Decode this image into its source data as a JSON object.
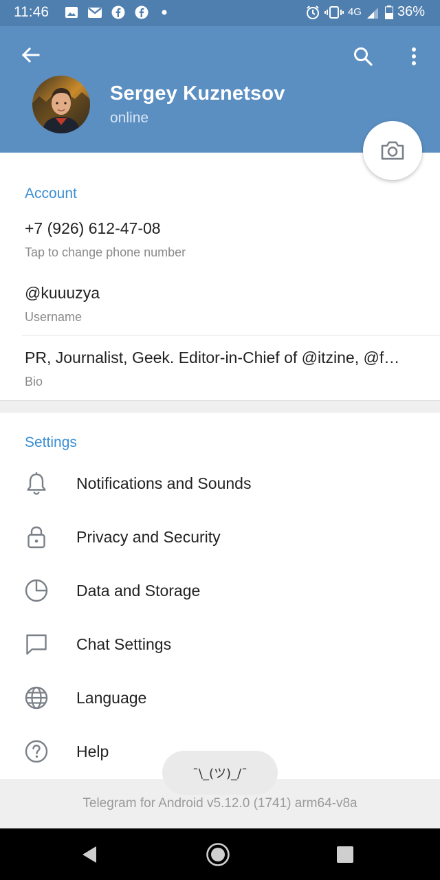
{
  "status_bar": {
    "time": "11:46",
    "network": "4G",
    "battery": "36%",
    "notification_icons": [
      "image-icon",
      "gmail-icon",
      "facebook-icon",
      "facebook-icon",
      "dot-icon"
    ],
    "right_icons": [
      "alarm-icon",
      "vibrate-icon",
      "signal-icon",
      "battery-icon"
    ]
  },
  "header": {
    "name": "Sergey Kuznetsov",
    "status": "online",
    "background_color": "#5b8fc2"
  },
  "account": {
    "title": "Account",
    "phone": "+7 (926) 612-47-08",
    "phone_hint": "Tap to change phone number",
    "username": "@kuuuzya",
    "username_hint": "Username",
    "bio": "PR, Journalist, Geek. Editor-in-Chief of @itzine, @f…",
    "bio_hint": "Bio"
  },
  "settings": {
    "title": "Settings",
    "items": [
      {
        "label": "Notifications and Sounds",
        "icon": "bell-icon"
      },
      {
        "label": "Privacy and Security",
        "icon": "lock-icon"
      },
      {
        "label": "Data and Storage",
        "icon": "pie-chart-icon"
      },
      {
        "label": "Chat Settings",
        "icon": "chat-bubble-icon"
      },
      {
        "label": "Language",
        "icon": "globe-icon"
      },
      {
        "label": "Help",
        "icon": "question-icon"
      }
    ]
  },
  "footer": {
    "version": "Telegram for Android v5.12.0 (1741) arm64-v8a",
    "toast": "¯\\_(ツ)_/¯"
  },
  "colors": {
    "accent": "#3a8ed4",
    "header": "#5b8fc2",
    "status_bar": "#4f7fae"
  }
}
